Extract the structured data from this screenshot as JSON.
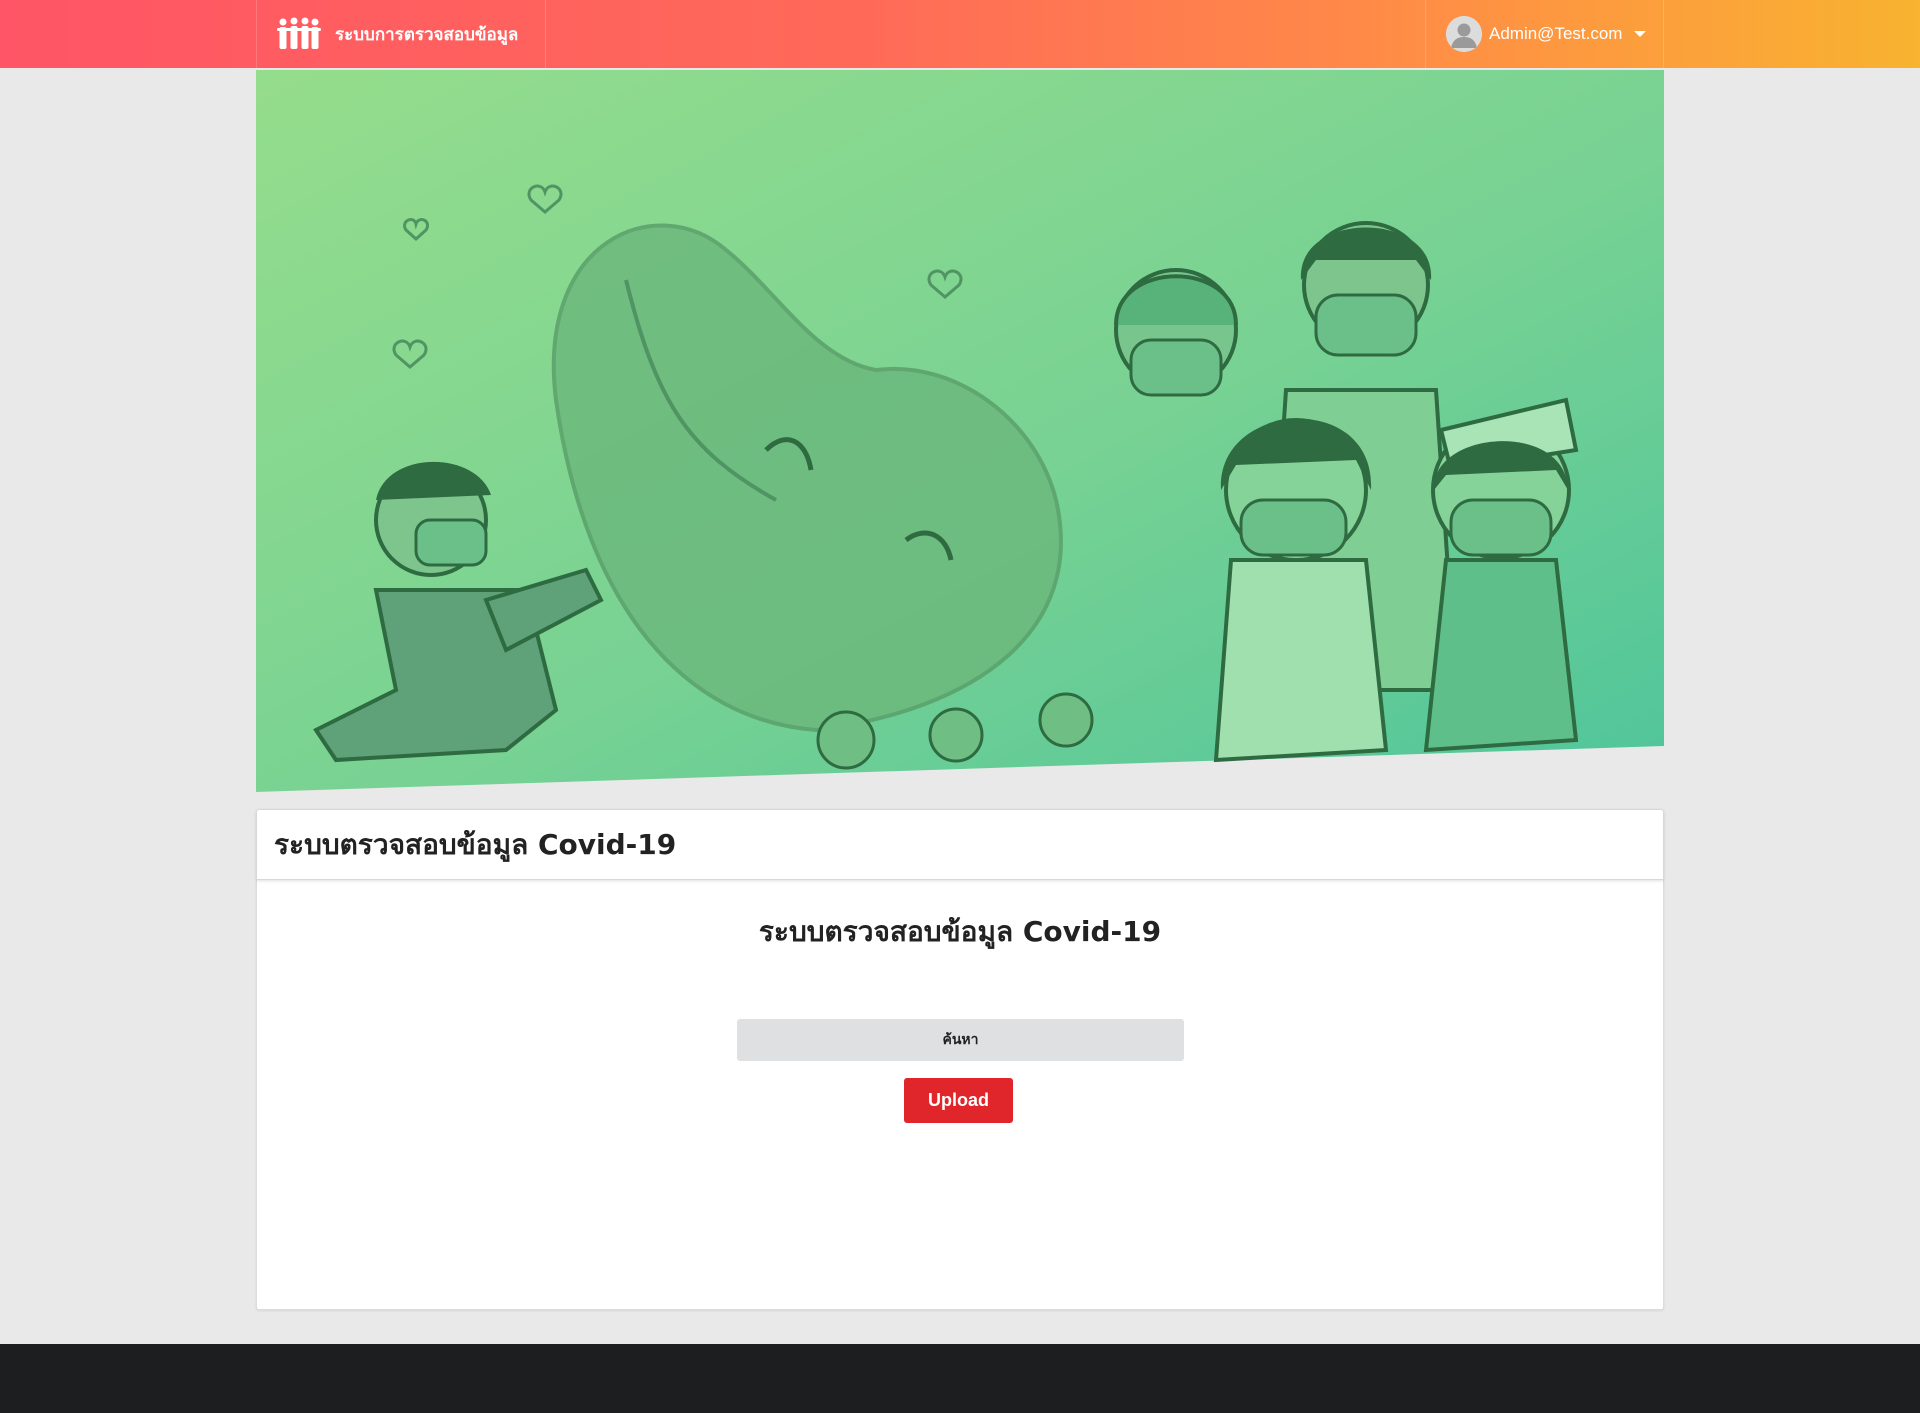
{
  "header": {
    "brand_title": "ระบบการตรวจสอบข้อมูล",
    "user_email": "Admin@Test.com"
  },
  "card": {
    "header_title": "ระบบตรวจสอบข้อมูล Covid-19",
    "body_title": "ระบบตรวจสอบข้อมูล Covid-19",
    "search_label": "ค้นหา",
    "upload_label": "Upload"
  },
  "colors": {
    "topbar_start": "#ff5566",
    "topbar_end": "#f8b330",
    "hero_green": "#7fd692",
    "upload_red": "#e0262a",
    "footer": "#1d1e20"
  },
  "icons": {
    "brand": "people-group-icon",
    "avatar": "user-avatar-icon",
    "caret": "caret-down-icon"
  }
}
